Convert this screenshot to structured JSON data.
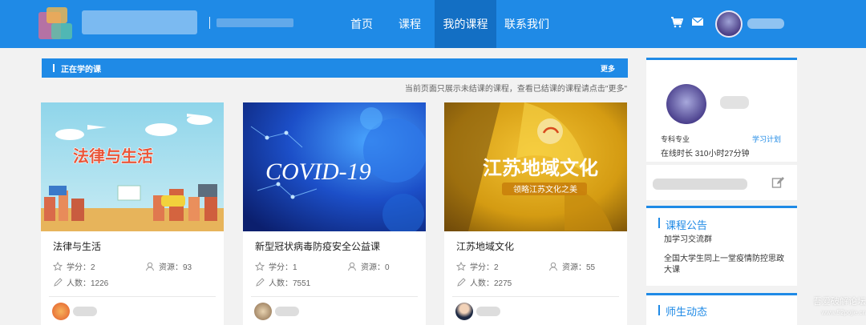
{
  "header": {
    "nav": [
      {
        "label": "首页"
      },
      {
        "label": "课程"
      },
      {
        "label": "我的课程",
        "active": true
      },
      {
        "label": "联系我们"
      }
    ],
    "icons": [
      "cart-icon",
      "mail-icon"
    ],
    "brand_color": "#1f8ae6",
    "active_color": "#136fc4"
  },
  "learning": {
    "title": "正在学的课",
    "more_label": "更多",
    "hint": "当前页面只展示未结课的课程，查看已结课的课程请点击\"更多\""
  },
  "courses": [
    {
      "cover_text": "法律与生活",
      "title": "法律与生活",
      "credit": "学分：2",
      "resources": "资源：93",
      "students": "人数：1226"
    },
    {
      "cover_text": "COVID-19",
      "title": "新型冠状病毒防疫安全公益课",
      "credit": "学分：1",
      "resources": "资源：0",
      "students": "人数：7551"
    },
    {
      "cover_text": "江苏地域文化",
      "cover_subtext": "领略江苏文化之美",
      "title": "江苏地域文化",
      "credit": "学分：2",
      "resources": "资源：55",
      "students": "人数：2275"
    }
  ],
  "profile": {
    "major": "专科专业",
    "plan_label": "学习计划",
    "online": "在线时长 310小时27分钟"
  },
  "announcements": {
    "title": "课程公告",
    "items": [
      "加学习交流群",
      "全国大学生同上一堂疫情防控思政大课"
    ]
  },
  "dynamics": {
    "title": "师生动态"
  },
  "watermark": {
    "line1": "吾爱破解论坛",
    "line2": "www.52pojie.cn"
  }
}
